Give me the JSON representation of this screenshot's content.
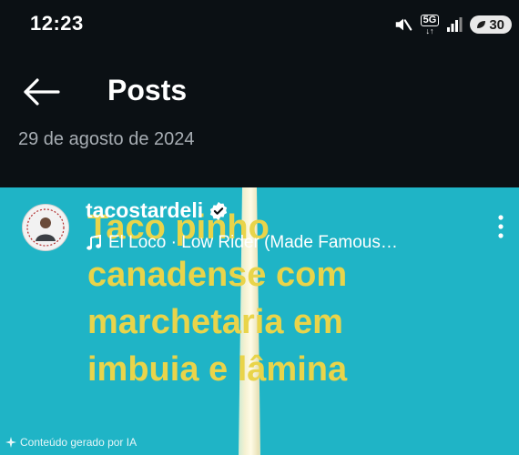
{
  "status_bar": {
    "time": "12:23",
    "network": "5G",
    "network_arrows": "↓↑",
    "battery": "30",
    "icons": [
      "mute-icon",
      "signal-icon",
      "battery-saver-icon"
    ]
  },
  "header": {
    "title": "Posts",
    "date": "29 de agosto de 2024",
    "back_icon": "arrow-left-icon"
  },
  "post": {
    "username": "tacostardeli",
    "verified": true,
    "music": "El Loco · Low Rider (Made Famous…",
    "overlay_lines": [
      "Taco pinho",
      "canadense com",
      "marchetaria em",
      "imbuia e lâmina"
    ],
    "ai_label": "Conteúdo gerado por IA",
    "more_icon": "more-vertical-icon"
  },
  "colors": {
    "background": "#0b1014",
    "media_background": "#1fb4c6",
    "overlay_text": "#e9d44a",
    "secondary_text": "#a7adb3"
  }
}
